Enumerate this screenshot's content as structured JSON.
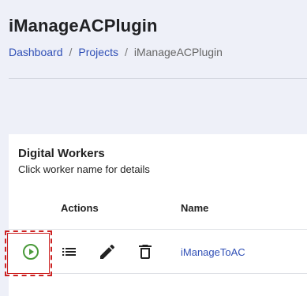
{
  "header": {
    "title": "iManageACPlugin"
  },
  "breadcrumb": {
    "items": [
      "Dashboard",
      "Projects"
    ],
    "separator": "/",
    "current": "iManageACPlugin"
  },
  "digital_workers": {
    "title": "Digital Workers",
    "subtitle": "Click worker name for details",
    "columns": {
      "actions": "Actions",
      "name": "Name"
    },
    "rows": [
      {
        "name": "iManageToAC",
        "actions": [
          "play-circle-icon",
          "list-icon",
          "pencil-icon",
          "trash-icon"
        ]
      }
    ]
  },
  "colors": {
    "link": "#2f4fb6",
    "run_icon": "#4a9a3a",
    "highlight": "#cc2222",
    "background": "#eef0f8",
    "card": "#ffffff"
  }
}
